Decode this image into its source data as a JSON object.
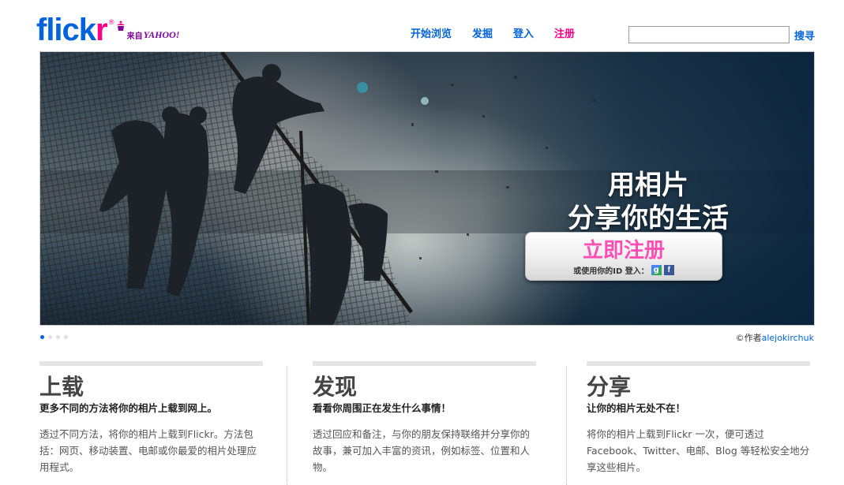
{
  "header": {
    "logo": {
      "flickr_a": "flick",
      "flickr_b": "r",
      "registered": "®",
      "from": "来自",
      "yahoo": "YAHOO!"
    },
    "nav": [
      {
        "label": "开始浏览"
      },
      {
        "label": "发掘"
      },
      {
        "label": "登入"
      },
      {
        "label": "注册"
      }
    ],
    "search": {
      "value": "",
      "placeholder": "",
      "button_label": "搜寻"
    }
  },
  "hero": {
    "title_line1": "用相片",
    "title_line2": "分享你的生活",
    "cta_label": "立即注册",
    "alt_login_label": "或使用你的ID 登入：",
    "google_icon_glyph": "g",
    "facebook_icon_glyph": "f",
    "credit_prefix": "©作者",
    "credit_author": "alejokirchuk"
  },
  "carousel": {
    "dots": 4,
    "active_index": 0
  },
  "columns": [
    {
      "title": "上载",
      "subtitle": "更多不同的方法将你的相片上载到网上。",
      "body": "透过不同方法，将你的相片上载到Flickr。方法包括：网页、移动装置、电邮或你最爱的相片处理应用程式。"
    },
    {
      "title": "发现",
      "subtitle": "看看你周围正在发生什么事情！",
      "body": "透过回应和备注，与你的朋友保持联络并分享你的故事，兼可加入丰富的资讯，例如标签、位置和人物。"
    },
    {
      "title": "分享",
      "subtitle": "让你的相片无处不在！",
      "body": "将你的相片上载到Flickr 一次，便可透过 Facebook、Twitter、电邮、Blog 等轻松安全地分享这些相片。"
    }
  ],
  "colors": {
    "brand_blue": "#0063dc",
    "brand_pink": "#ff0084",
    "cta_pink": "#ff4fb4",
    "yahoo_purple": "#7b0099"
  }
}
